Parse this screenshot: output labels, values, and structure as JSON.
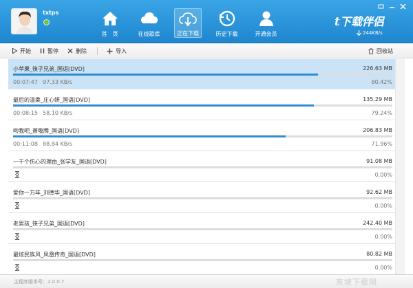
{
  "user": {
    "name": "txtps"
  },
  "nav": [
    {
      "label": "首　页",
      "icon": "home-icon"
    },
    {
      "label": "在线歌库",
      "icon": "cloud-icon"
    },
    {
      "label": "正在下载",
      "icon": "cloud-download-icon",
      "active": true
    },
    {
      "label": "历史下载",
      "icon": "history-icon"
    },
    {
      "label": "开通会员",
      "icon": "member-icon"
    }
  ],
  "brand": {
    "text": "下载伴侣",
    "speed": "244KB/s"
  },
  "toolbar": {
    "start": "开始",
    "pause": "暂停",
    "delete": "删除",
    "import": "导入",
    "recycle": "回收站"
  },
  "tasks": [
    {
      "name": "小苹果_筷子兄弟_国语[DVD]",
      "size": "226.63 MB",
      "time": "00:07:47",
      "speed": "97.33 KB/s",
      "percent": "80.42%",
      "progress": 80.42,
      "selected": true
    },
    {
      "name": "最后的温柔_庄心妍_国语[DVD]",
      "size": "135.29 MB",
      "time": "00:08:15",
      "speed": "58.10 KB/s",
      "percent": "79.24%",
      "progress": 79.24
    },
    {
      "name": "吻我吧_萧敬腾_国语[DVD]",
      "size": "206.83 MB",
      "time": "00:11:08",
      "speed": "88.84 KB/s",
      "percent": "71.96%",
      "progress": 71.96
    },
    {
      "name": "一千个伤心的理由_张学友_国语[DVD]",
      "size": "91.08 MB",
      "time": "",
      "speed": "",
      "percent": "0.00%",
      "progress": 0,
      "waiting": true
    },
    {
      "name": "爱你一万年_刘德华_国语[DVD]",
      "size": "92.62 MB",
      "time": "",
      "speed": "",
      "percent": "0.00%",
      "progress": 0,
      "waiting": true
    },
    {
      "name": "老男孩_筷子兄弟_国语[DVD]",
      "size": "242.40 MB",
      "time": "",
      "speed": "",
      "percent": "0.00%",
      "progress": 0,
      "waiting": true
    },
    {
      "name": "最炫民族风_凤凰传奇_国语[DVD]",
      "size": "80.82 MB",
      "time": "",
      "speed": "",
      "percent": "0.00%",
      "progress": 0,
      "waiting": true
    }
  ],
  "status": {
    "version": "主程序版本号：2.0.0.7",
    "watermark": "东坡下载网"
  },
  "colors": {
    "header": "#2a95dc",
    "progress": "#2c8dd3",
    "selected_row": "#cbe3f6"
  }
}
